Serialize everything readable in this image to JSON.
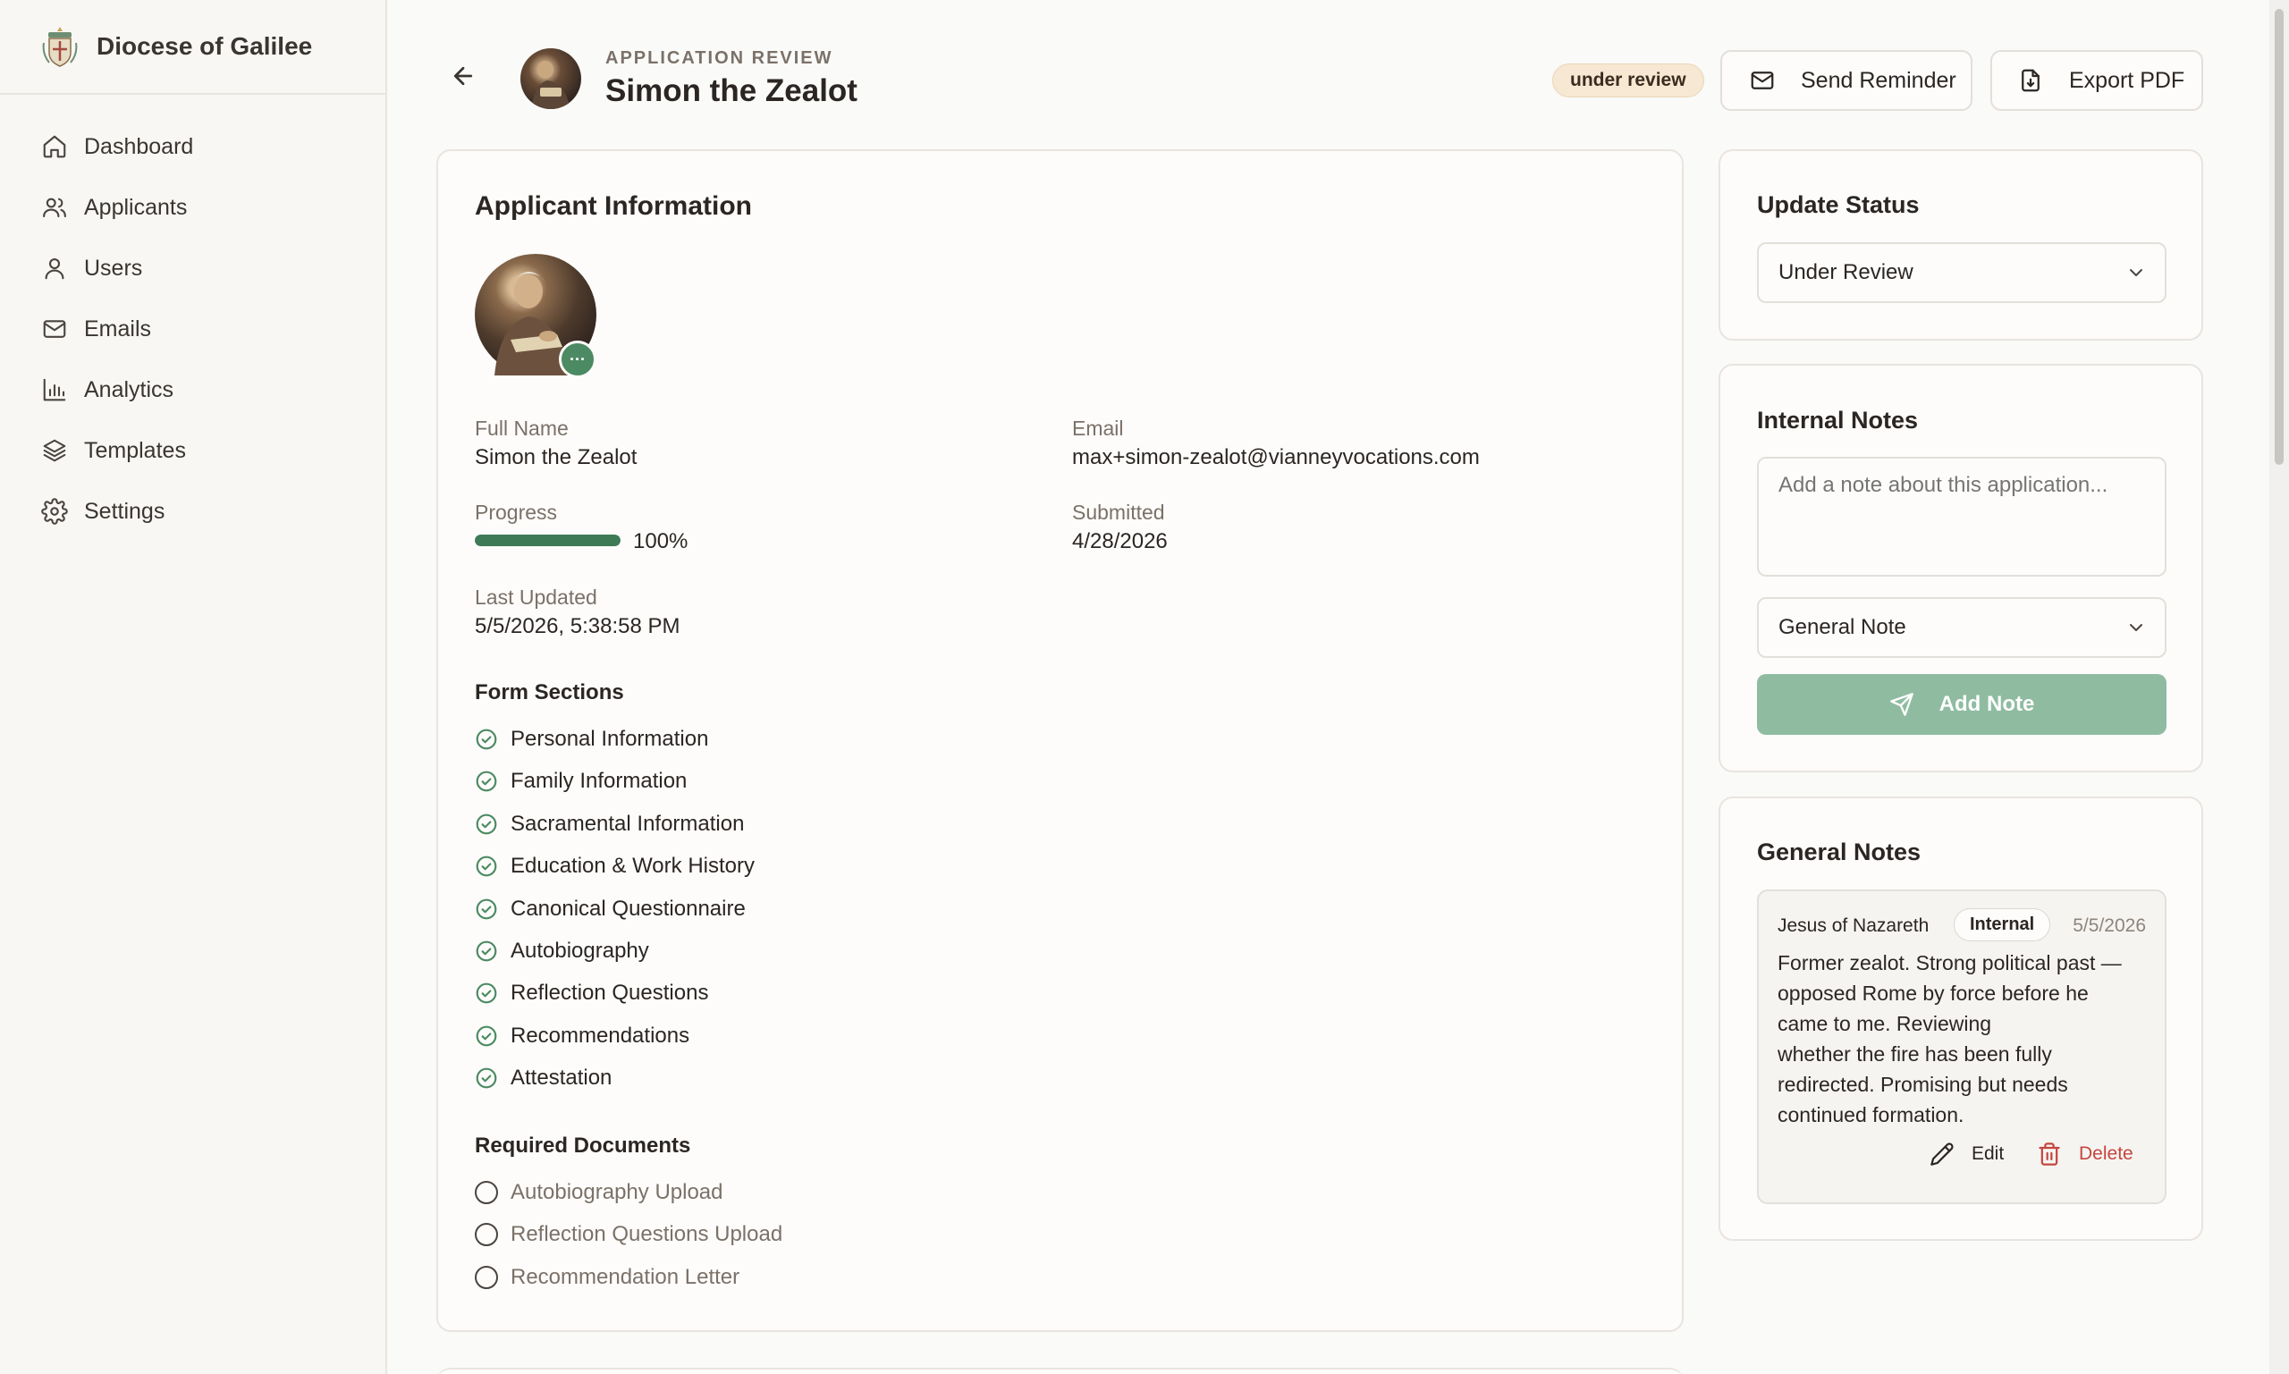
{
  "sidebar": {
    "brand": "Diocese of Galilee",
    "items": [
      {
        "label": "Dashboard",
        "icon": "home-icon"
      },
      {
        "label": "Applicants",
        "icon": "users-icon"
      },
      {
        "label": "Users",
        "icon": "user-icon"
      },
      {
        "label": "Emails",
        "icon": "mail-icon"
      },
      {
        "label": "Analytics",
        "icon": "bar-chart-icon"
      },
      {
        "label": "Templates",
        "icon": "layers-icon"
      },
      {
        "label": "Settings",
        "icon": "gear-icon"
      }
    ]
  },
  "header": {
    "kicker": "APPLICATION REVIEW",
    "title": "Simon the Zealot",
    "status_badge": "under review",
    "send_reminder": "Send Reminder",
    "export_pdf": "Export PDF"
  },
  "applicant": {
    "card_title": "Applicant Information",
    "full_name_label": "Full Name",
    "full_name": "Simon the Zealot",
    "email_label": "Email",
    "email": "max+simon-zealot@vianneyvocations.com",
    "progress_label": "Progress",
    "progress_text": "100%",
    "progress_fraction": 1.0,
    "submitted_label": "Submitted",
    "submitted": "4/28/2026",
    "last_updated_label": "Last Updated",
    "last_updated": "5/5/2026, 5:38:58 PM",
    "form_sections_title": "Form Sections",
    "form_sections": [
      "Personal Information",
      "Family Information",
      "Sacramental Information",
      "Education & Work History",
      "Canonical Questionnaire",
      "Autobiography",
      "Reflection Questions",
      "Recommendations",
      "Attestation"
    ],
    "required_docs_title": "Required Documents",
    "required_docs": [
      "Autobiography Upload",
      "Reflection Questions Upload",
      "Recommendation Letter"
    ]
  },
  "update_status": {
    "title": "Update Status",
    "selected": "Under Review"
  },
  "internal_notes": {
    "title": "Internal Notes",
    "placeholder": "Add a note about this application...",
    "note_type": "General Note",
    "add_label": "Add Note"
  },
  "general_notes": {
    "title": "General Notes",
    "note": {
      "author": "Jesus of Nazareth",
      "badge": "Internal",
      "date": "5/5/2026",
      "lines": [
        "Former zealot. Strong political past —",
        "opposed Rome by force before he",
        "came to me. Reviewing",
        "whether the fire has been fully",
        "redirected. Promising but needs",
        "continued formation."
      ],
      "edit_label": "Edit",
      "delete_label": "Delete"
    }
  },
  "colors": {
    "accent_green": "#4c8a63",
    "status_badge_bg": "#f6e8d3",
    "delete_red": "#c4463f"
  }
}
